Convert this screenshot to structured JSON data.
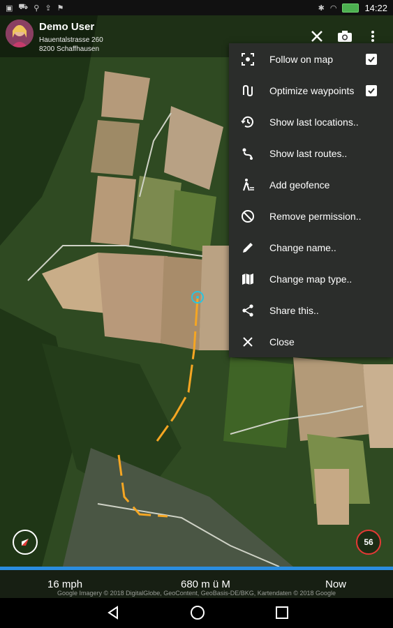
{
  "status": {
    "time": "14:22"
  },
  "header": {
    "user_name": "Demo User",
    "address_line1": "Hauentalstrasse 260",
    "address_line2": "8200 Schaffhausen"
  },
  "menu": {
    "items": [
      {
        "label": "Follow on map",
        "icon": "target-icon",
        "checked": true
      },
      {
        "label": "Optimize waypoints",
        "icon": "route-optimize-icon",
        "checked": true
      },
      {
        "label": "Show last locations..",
        "icon": "history-icon"
      },
      {
        "label": "Show last routes..",
        "icon": "routes-icon"
      },
      {
        "label": "Add geofence",
        "icon": "geofence-icon"
      },
      {
        "label": "Remove permission..",
        "icon": "block-icon"
      },
      {
        "label": "Change name..",
        "icon": "pencil-icon"
      },
      {
        "label": "Change map type..",
        "icon": "map-icon"
      },
      {
        "label": "Share this..",
        "icon": "share-icon"
      },
      {
        "label": "Close",
        "icon": "close-icon"
      }
    ]
  },
  "info": {
    "speed": "16 mph",
    "altitude": "680 m ü M",
    "time": "Now"
  },
  "badge": {
    "count": "56"
  },
  "copyright": "Google  Imagery © 2018 DigitalGlobe, GeoContent, GeoBasis-DE/BKG, Kartendaten © 2018 Google",
  "colors": {
    "accent": "#2a8de0",
    "route": "#f5a623",
    "marker": "#29c4e0",
    "badge_ring": "#e53935"
  }
}
